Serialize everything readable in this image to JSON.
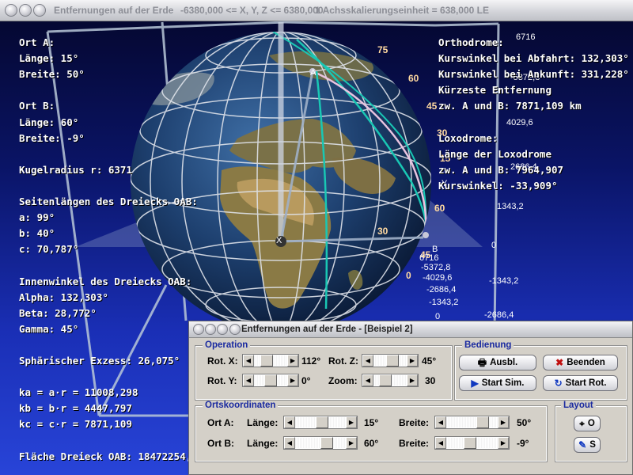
{
  "main_window": {
    "title": "Entfernungen auf der Erde",
    "range_text": "-6380,000 <= X, Y, Z <= 6380,000",
    "scale_text": "1 Achsskalierungseinheit = 638,000 LE"
  },
  "left_info": [
    "Ort A:",
    "Länge: 15°",
    "Breite: 50°",
    "",
    "Ort B:",
    "Länge: 60°",
    "Breite: -9°",
    "",
    "Kugelradius r: 6371",
    "",
    "Seitenlängen des Dreiecks OAB:",
    "a: 99°",
    "b: 40°",
    "c: 70,787°",
    "",
    "Innenwinkel des Dreiecks OAB:",
    "Alpha: 132,303°",
    "Beta: 28,772°",
    "Gamma: 45°",
    "",
    "Sphärischer Exzess: 26,075°",
    "",
    "ka = a·r = 11008,298",
    "kb = b·r = 4447,797",
    "kc = c·r = 7871,109",
    "",
    "Fläche Dreieck OAB: 18472254,"
  ],
  "right_info": [
    "Orthodrome:",
    "Kurswinkel bei Abfahrt: 132,303°",
    "Kurswinkel bei Ankunft: 331,228°",
    "Kürzeste Entfernung",
    "zw. A und B: 7871,109 km",
    "",
    "Loxodrome:",
    "Länge der Loxodrome",
    "zw. A und B: 7964,907",
    "Kurswinkel: -33,909°"
  ],
  "scene": {
    "axis_x_label": "X",
    "axis_y_label": "Y",
    "point_a_label": "A",
    "point_b_label": "B",
    "lat_labels": [
      "75",
      "60",
      "45",
      "30",
      "15",
      "60",
      "30",
      "45",
      "0"
    ],
    "axis_ticks_top": [
      "6716",
      "-5372,8",
      "4029,6",
      "2686,4",
      "1343,2",
      "0"
    ],
    "axis_ticks_bottom": [
      "6716",
      "-5372,8",
      "-4029,6",
      "-2686,4",
      "-1343,2",
      "0",
      "-1343,2",
      "-2686,4"
    ]
  },
  "dialog": {
    "title": "Entfernungen auf der Erde - [Beispiel 2]",
    "operation": {
      "title": "Operation",
      "rot_x": {
        "label": "Rot. X:",
        "value": "112°",
        "level": 0.31
      },
      "rot_y": {
        "label": "Rot. Y:",
        "value": "0°",
        "level": 0.5
      },
      "rot_z": {
        "label": "Rot. Z:",
        "value": "45°",
        "level": 0.62
      },
      "zoom": {
        "label": "Zoom:",
        "value": "30",
        "level": 0.25
      }
    },
    "bedienung": {
      "title": "Bedienung",
      "ausbl": "Ausbl.",
      "beenden": "Beenden",
      "start_sim": "Start Sim.",
      "start_rot": "Start Rot."
    },
    "ortskoordinaten": {
      "title": "Ortskoordinaten",
      "ort_a": {
        "label": "Ort A:",
        "laenge_label": "Länge:",
        "laenge_value": "15°",
        "laenge_level": 0.54,
        "breite_label": "Breite:",
        "breite_value": "50°",
        "breite_level": 0.78
      },
      "ort_b": {
        "label": "Ort B:",
        "laenge_label": "Länge:",
        "laenge_value": "60°",
        "laenge_level": 0.67,
        "breite_label": "Breite:",
        "breite_value": "-9°",
        "breite_level": 0.45
      }
    },
    "layout": {
      "title": "Layout",
      "btn_o": "O",
      "btn_s": "S"
    }
  },
  "colors": {
    "globe_ocean": "#1d3f6e",
    "grid": "#dfe3ea",
    "orthodrome": "#19c7b4",
    "loxodrome": "#e9c4e0",
    "dialog_bg": "#d4d0c8",
    "group_title": "#1a2aa0"
  }
}
